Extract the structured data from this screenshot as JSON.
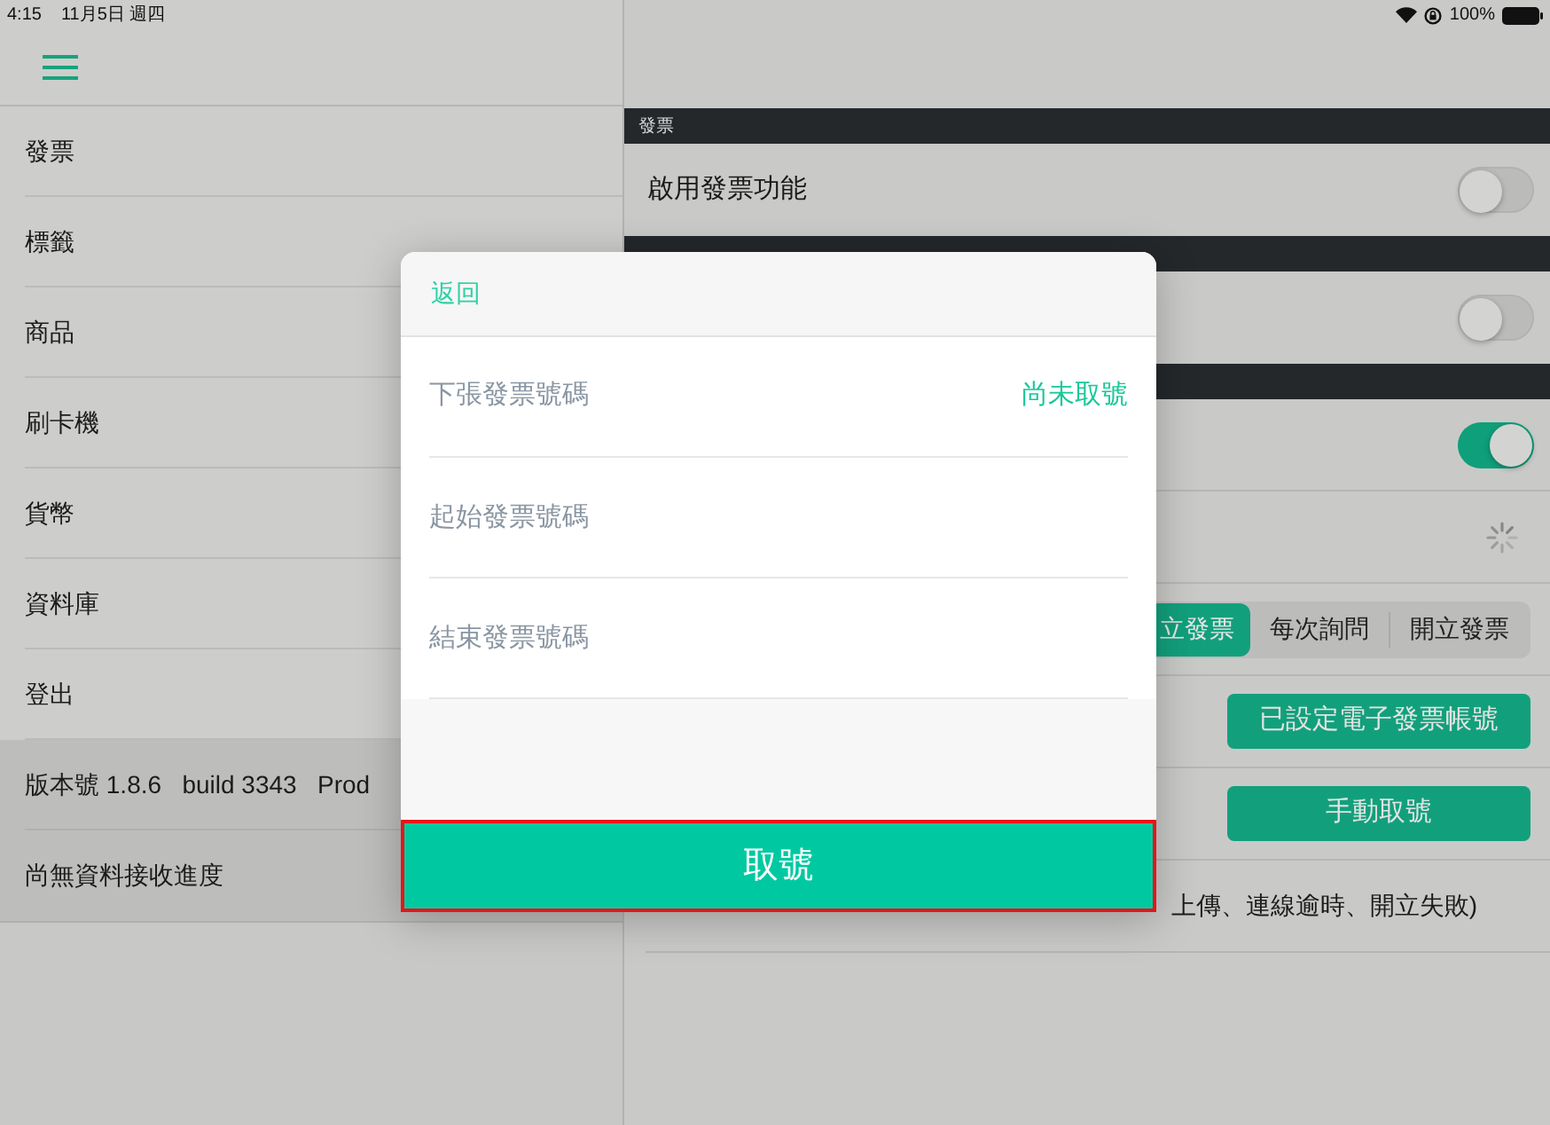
{
  "status_bar": {
    "time": "4:15",
    "date": "11月5日 週四",
    "battery": "100%"
  },
  "sidebar": {
    "items": [
      {
        "label": "發票"
      },
      {
        "label": "標籤"
      },
      {
        "label": "商品"
      },
      {
        "label": "刷卡機"
      },
      {
        "label": "貨幣"
      },
      {
        "label": "資料庫"
      },
      {
        "label": "登出"
      }
    ],
    "info": [
      {
        "text": "版本號 1.8.6   build 3343   Prod"
      },
      {
        "text": "尚無資料接收進度"
      }
    ]
  },
  "settings": {
    "sections": [
      {
        "title": "發票",
        "rows": [
          {
            "kind": "toggle",
            "label": "啟用發票功能",
            "on": false
          }
        ]
      },
      {
        "rows": [
          {
            "kind": "toggle",
            "on": false
          }
        ]
      },
      {
        "rows": [
          {
            "kind": "toggle",
            "on": true
          },
          {
            "kind": "spinner"
          },
          {
            "kind": "segmented",
            "options": [
              {
                "label": "立發票",
                "selected": true
              },
              {
                "label": "每次詢問",
                "selected": false
              },
              {
                "label": "開立發票",
                "selected": false
              }
            ]
          },
          {
            "kind": "button",
            "label": "已設定電子發票帳號"
          },
          {
            "kind": "button",
            "label": "手動取號"
          },
          {
            "kind": "text",
            "text": "上傳、連線逾時、開立失敗)"
          }
        ]
      }
    ]
  },
  "dialog": {
    "back": "返回",
    "rows": [
      {
        "kind": "info",
        "label": "下張發票號碼",
        "value": "尚未取號"
      },
      {
        "kind": "input",
        "placeholder": "起始發票號碼"
      },
      {
        "kind": "input",
        "placeholder": "結束發票號碼"
      }
    ],
    "primary_button": {
      "label": "取號",
      "highlighted": true
    }
  }
}
